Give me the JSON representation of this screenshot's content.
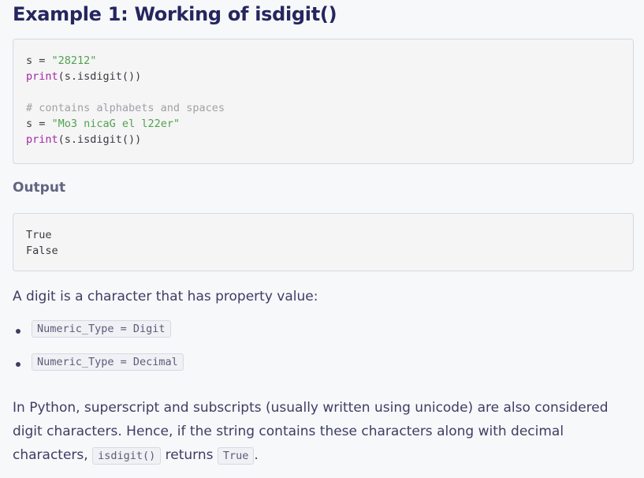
{
  "heading": "Example 1: Working of isdigit()",
  "code_example": {
    "line1": {
      "var": "s",
      "op": " = ",
      "str": "\"28212\""
    },
    "line2": {
      "fn": "print",
      "rest": "(s.isdigit())"
    },
    "comment": "# contains alphabets and spaces",
    "line4": {
      "var": "s",
      "op": " = ",
      "str": "\"Mo3 nicaG el l22er\""
    },
    "line5": {
      "fn": "print",
      "rest": "(s.isdigit())"
    }
  },
  "output_label": "Output",
  "output_lines": [
    "True",
    "False"
  ],
  "paragraph1": "A digit is a character that has property value:",
  "bullets": [
    "Numeric_Type = Digit",
    "Numeric_Type = Decimal"
  ],
  "paragraph2": {
    "text_a": "In Python, superscript and subscripts (usually written using unicode) are also considered digit characters. Hence, if the string contains these characters along with decimal characters,",
    "code_a": "isdigit()",
    "text_b": " returns ",
    "code_b": "True",
    "text_c": "."
  }
}
